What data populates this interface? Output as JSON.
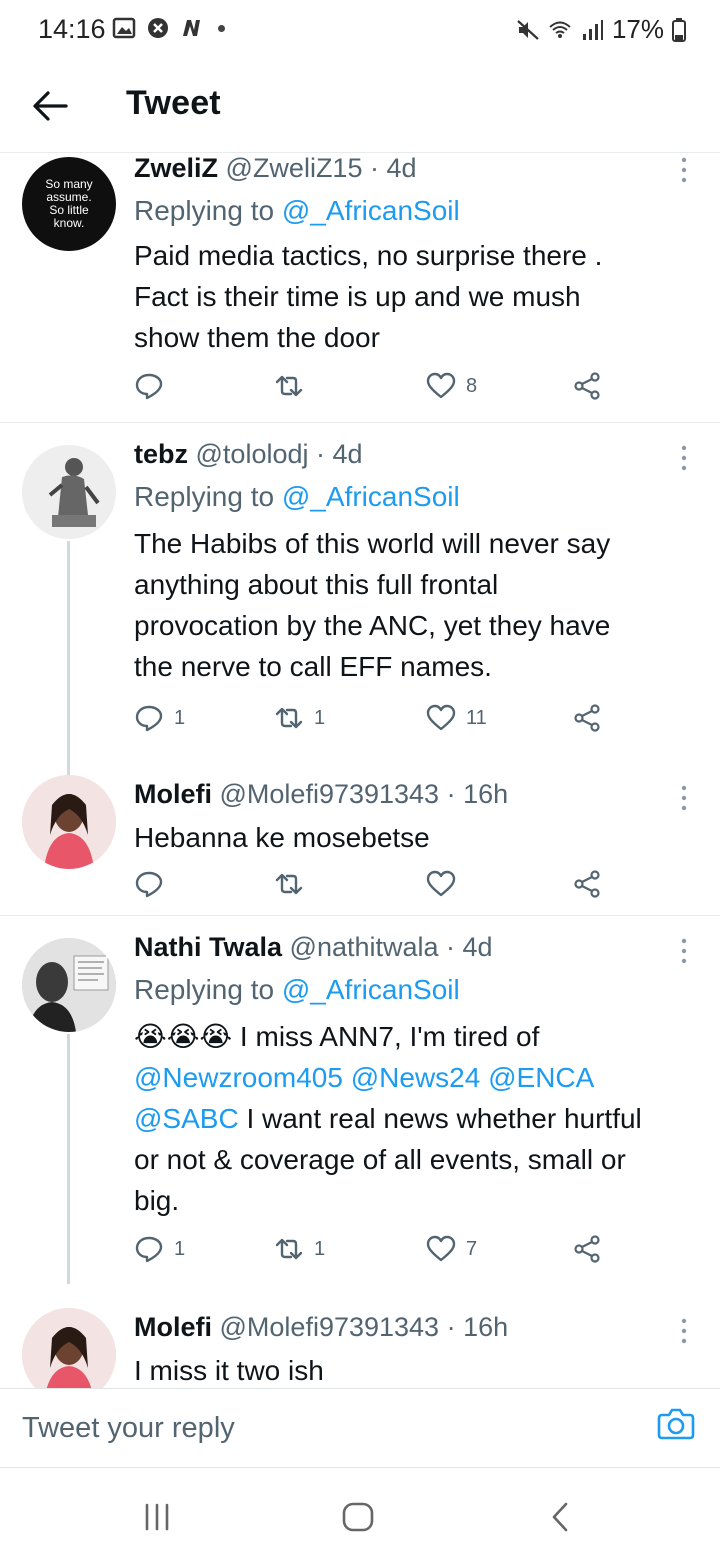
{
  "status_bar": {
    "time": "14:16",
    "battery": "17%"
  },
  "header": {
    "title": "Tweet"
  },
  "tweets": [
    {
      "name": "ZweliZ",
      "meta": "@ZweliZ15 · 4d",
      "replying_label": "Replying to",
      "replying_to": "@_AfricanSoil",
      "avatar_text": [
        "So many",
        "assume.",
        "So little",
        "know."
      ],
      "lines": [
        "Paid media tactics, no surprise there .",
        "Fact is their time is up and we mush",
        "show them the door"
      ],
      "counts": {
        "reply": "",
        "retweet": "",
        "like": "8"
      }
    },
    {
      "name": "tebz",
      "meta": "@tololodj · 4d",
      "replying_label": "Replying to",
      "replying_to": "@_AfricanSoil",
      "lines": [
        "The Habibs of this world will never say",
        "anything about this full frontal",
        "provocation by the ANC, yet they have",
        "the nerve to call EFF names."
      ],
      "counts": {
        "reply": "1",
        "retweet": "1",
        "like": "11"
      }
    },
    {
      "name": "Molefi",
      "meta": "@Molefi97391343 · 16h",
      "lines": [
        "Hebanna ke mosebetse"
      ],
      "counts": {
        "reply": "",
        "retweet": "",
        "like": ""
      }
    },
    {
      "name": "Nathi Twala",
      "meta": "@nathitwala · 4d",
      "replying_label": "Replying to",
      "replying_to": "@_AfricanSoil",
      "emoji": "😭😭😭",
      "line1_text": " I miss ANN7, I'm tired of",
      "mentions": [
        "@Newzroom405",
        "@News24",
        "@ENCA",
        "@SABC"
      ],
      "line4_rest": " I want real news whether hurtful",
      "lines_after": [
        "or not & coverage of all events, small or",
        "big."
      ],
      "counts": {
        "reply": "1",
        "retweet": "1",
        "like": "7"
      }
    },
    {
      "name": "Molefi",
      "meta": "@Molefi97391343 · 16h",
      "lines": [
        "I miss it two ish"
      ]
    }
  ],
  "reply_bar": {
    "placeholder": "Tweet your reply"
  },
  "icons": {
    "accent": "#1d9bf0",
    "action_color": "#536471"
  }
}
